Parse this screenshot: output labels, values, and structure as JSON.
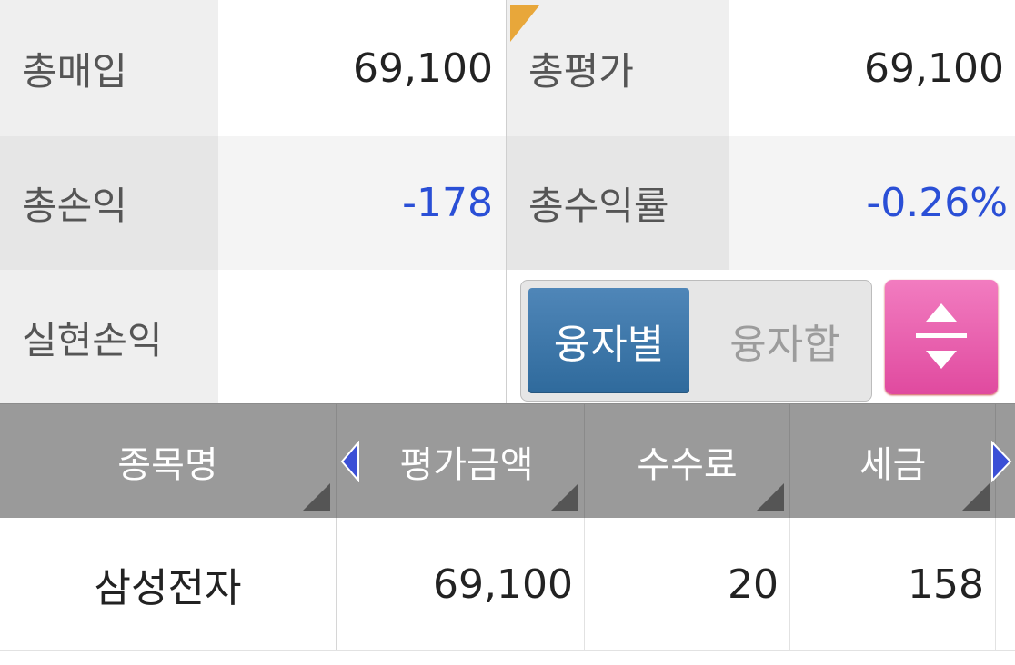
{
  "summary": {
    "total_purchase_label": "총매입",
    "total_purchase_value": "69,100",
    "total_eval_label": "총평가",
    "total_eval_value": "69,100",
    "total_pl_label": "총손익",
    "total_pl_value": "-178",
    "total_return_label": "총수익률",
    "total_return_value": "-0.26%",
    "realized_pl_label": "실현손익",
    "realized_pl_value": ""
  },
  "toggle": {
    "by_loan": "융자별",
    "loan_sum": "융자합"
  },
  "table": {
    "headers": [
      "종목명",
      "평가금액",
      "수수료",
      "세금"
    ],
    "rows": [
      {
        "name": "삼성전자",
        "eval": "69,100",
        "fee": "20",
        "tax": "158"
      }
    ]
  },
  "colors": {
    "negative": "#2a4fd6",
    "active_toggle": "#3a76a8",
    "pink_button": "#e85aab",
    "header_bg": "#9a9a9a"
  }
}
